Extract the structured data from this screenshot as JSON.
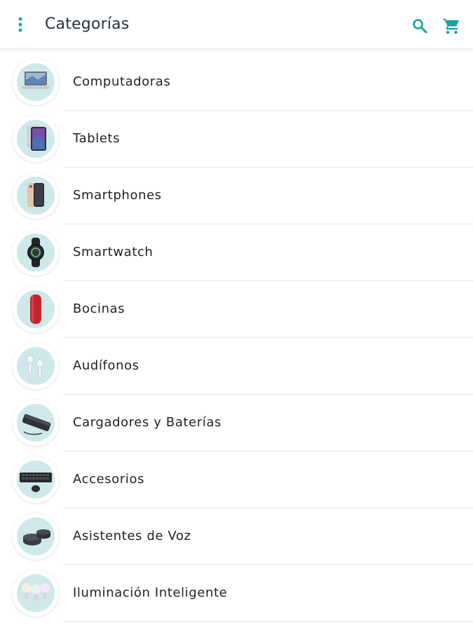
{
  "colors": {
    "accent": "#14a3a3",
    "thumb_bg": "#cfe9ea"
  },
  "appbar": {
    "title": "Categorías",
    "menu_icon": "more-vert-icon",
    "search_icon": "search-icon",
    "cart_icon": "shopping-cart-icon"
  },
  "categories": [
    {
      "label": "Computadoras",
      "icon": "laptop-image"
    },
    {
      "label": "Tablets",
      "icon": "tablet-image"
    },
    {
      "label": "Smartphones",
      "icon": "smartphone-image"
    },
    {
      "label": "Smartwatch",
      "icon": "smartwatch-image"
    },
    {
      "label": "Bocinas",
      "icon": "speaker-image"
    },
    {
      "label": "Audífonos",
      "icon": "earbuds-image"
    },
    {
      "label": "Cargadores y Baterías",
      "icon": "power-bank-image"
    },
    {
      "label": "Accesorios",
      "icon": "keyboard-mouse-image"
    },
    {
      "label": "Asistentes de Voz",
      "icon": "smart-speaker-image"
    },
    {
      "label": "Iluminación Inteligente",
      "icon": "smart-bulbs-image"
    }
  ]
}
